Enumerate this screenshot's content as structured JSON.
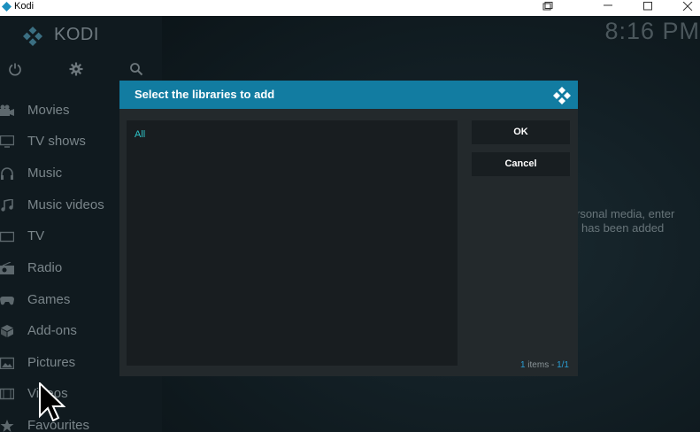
{
  "window": {
    "title": "Kodi"
  },
  "app": {
    "logo_text": "KODI",
    "clock": "8:16 PM"
  },
  "sidebar": {
    "top_icons": [
      "power-icon",
      "settings-icon",
      "search-icon"
    ],
    "items": [
      {
        "label": "Movies",
        "icon": "movie-camera-icon"
      },
      {
        "label": "TV shows",
        "icon": "monitor-icon"
      },
      {
        "label": "Music",
        "icon": "headphones-icon"
      },
      {
        "label": "Music videos",
        "icon": "music-note-icon"
      },
      {
        "label": "TV",
        "icon": "tv-icon"
      },
      {
        "label": "Radio",
        "icon": "radio-icon"
      },
      {
        "label": "Games",
        "icon": "gamepad-icon"
      },
      {
        "label": "Add-ons",
        "icon": "box-icon"
      },
      {
        "label": "Pictures",
        "icon": "picture-icon"
      },
      {
        "label": "Videos",
        "icon": "film-icon"
      },
      {
        "label": "Favourites",
        "icon": "star-icon"
      }
    ]
  },
  "background_text": {
    "line1": "rsonal media, enter",
    "line2": "has been added"
  },
  "dialog": {
    "title": "Select the libraries to add",
    "list": [
      "All"
    ],
    "ok_label": "OK",
    "cancel_label": "Cancel",
    "count": {
      "current": "1",
      "label": " items - ",
      "page": "1/1"
    }
  },
  "colors": {
    "accent": "#127ca1",
    "list_item": "#2ec5c9",
    "dialog_bg": "#23292c"
  }
}
